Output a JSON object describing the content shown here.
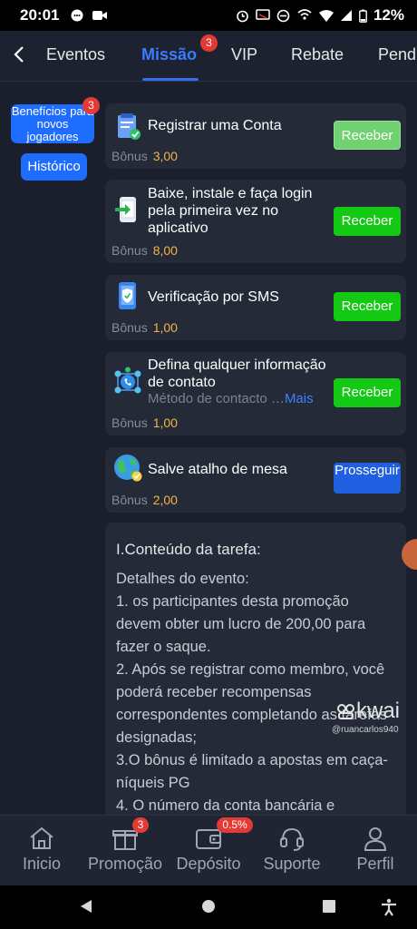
{
  "status_bar": {
    "time": "20:01",
    "battery": "12%"
  },
  "tabs": [
    {
      "label": "Eventos"
    },
    {
      "label": "Missão",
      "badge": "3",
      "active": true
    },
    {
      "label": "VIP"
    },
    {
      "label": "Rebate"
    },
    {
      "label": "Pend"
    }
  ],
  "sidebar": {
    "benefits_label": "Benefícios para novos jogadores",
    "benefits_badge": "3",
    "history_label": "Histórico"
  },
  "tasks": [
    {
      "title": "Registrar uma Conta",
      "bonus_label": "Bônus",
      "bonus": "3,00",
      "button": "Receber",
      "icon": "clipboard-check-icon"
    },
    {
      "title": "Baixe, instale e faça login pela primeira vez no aplicativo",
      "bonus_label": "Bônus",
      "bonus": "8,00",
      "button": "Receber",
      "icon": "phone-download-icon"
    },
    {
      "title": "Verificação por SMS",
      "bonus_label": "Bônus",
      "bonus": "1,00",
      "button": "Receber",
      "icon": "phone-shield-icon"
    },
    {
      "title": "Defina qualquer informação de contato",
      "subtitle": "Método de contacto …",
      "more": "Mais",
      "bonus_label": "Bônus",
      "bonus": "1,00",
      "button": "Receber",
      "icon": "contact-network-icon"
    },
    {
      "title": "Salve atalho de mesa",
      "bonus_label": "Bônus",
      "bonus": "2,00",
      "button": "Prosseguir",
      "icon": "globe-icon"
    }
  ],
  "description": {
    "heading": "I.Conteúdo da tarefa:",
    "lines": [
      "Detalhes do evento:",
      "1. os participantes desta promoção devem obter um lucro de 200,00 para fazer o saque.",
      "2. Após se registrar como membro, você poderá receber recompensas correspondentes completando as tarefas designadas;",
      "3.O bônus é limitado a apostas em caça-níqueis PG",
      "4. O número da conta bancária e"
    ]
  },
  "watermark": {
    "brand": "kwai",
    "user": "@ruancarlos940"
  },
  "bottom_nav": [
    {
      "label": "Inicio",
      "icon": "home-icon"
    },
    {
      "label": "Promoção",
      "icon": "gift-icon",
      "badge": "3"
    },
    {
      "label": "Depósito",
      "icon": "wallet-icon",
      "badge": "0.5%"
    },
    {
      "label": "Suporte",
      "icon": "headset-icon"
    },
    {
      "label": "Perfil",
      "icon": "user-icon"
    }
  ],
  "colors": {
    "accent": "#1f6dff",
    "green": "#14c914",
    "bonus": "#f5b53f",
    "badge": "#e53935"
  }
}
